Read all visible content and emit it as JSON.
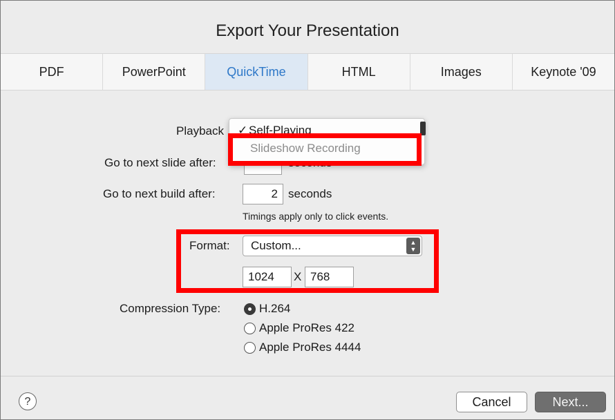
{
  "dialog": {
    "title": "Export Your Presentation"
  },
  "tabs": [
    {
      "label": "PDF",
      "active": false
    },
    {
      "label": "PowerPoint",
      "active": false
    },
    {
      "label": "QuickTime",
      "active": true
    },
    {
      "label": "HTML",
      "active": false
    },
    {
      "label": "Images",
      "active": false
    },
    {
      "label": "Keynote '09",
      "active": false
    }
  ],
  "playback": {
    "label": "Playback",
    "menu_items": [
      {
        "label": "Self-Playing",
        "checked": true,
        "enabled": true
      },
      {
        "label": "Slideshow Recording",
        "checked": false,
        "enabled": false
      }
    ]
  },
  "next_slide": {
    "label": "Go to next slide after:",
    "unit": "seconds"
  },
  "next_build": {
    "label": "Go to next build after:",
    "value": "2",
    "unit": "seconds"
  },
  "timing_hint": "Timings apply only to click events.",
  "format": {
    "label": "Format:",
    "selected": "Custom...",
    "width": "1024",
    "separator": "X",
    "height": "768"
  },
  "compression": {
    "label": "Compression Type:",
    "options": [
      {
        "label": "H.264",
        "selected": true
      },
      {
        "label": "Apple ProRes 422",
        "selected": false
      },
      {
        "label": "Apple ProRes 4444",
        "selected": false
      }
    ]
  },
  "footer": {
    "help_label": "?",
    "cancel_label": "Cancel",
    "next_label": "Next..."
  },
  "colors": {
    "highlight": "#ff0000",
    "active_tab_text": "#2e78c8",
    "active_tab_bg": "#dde8f4"
  }
}
